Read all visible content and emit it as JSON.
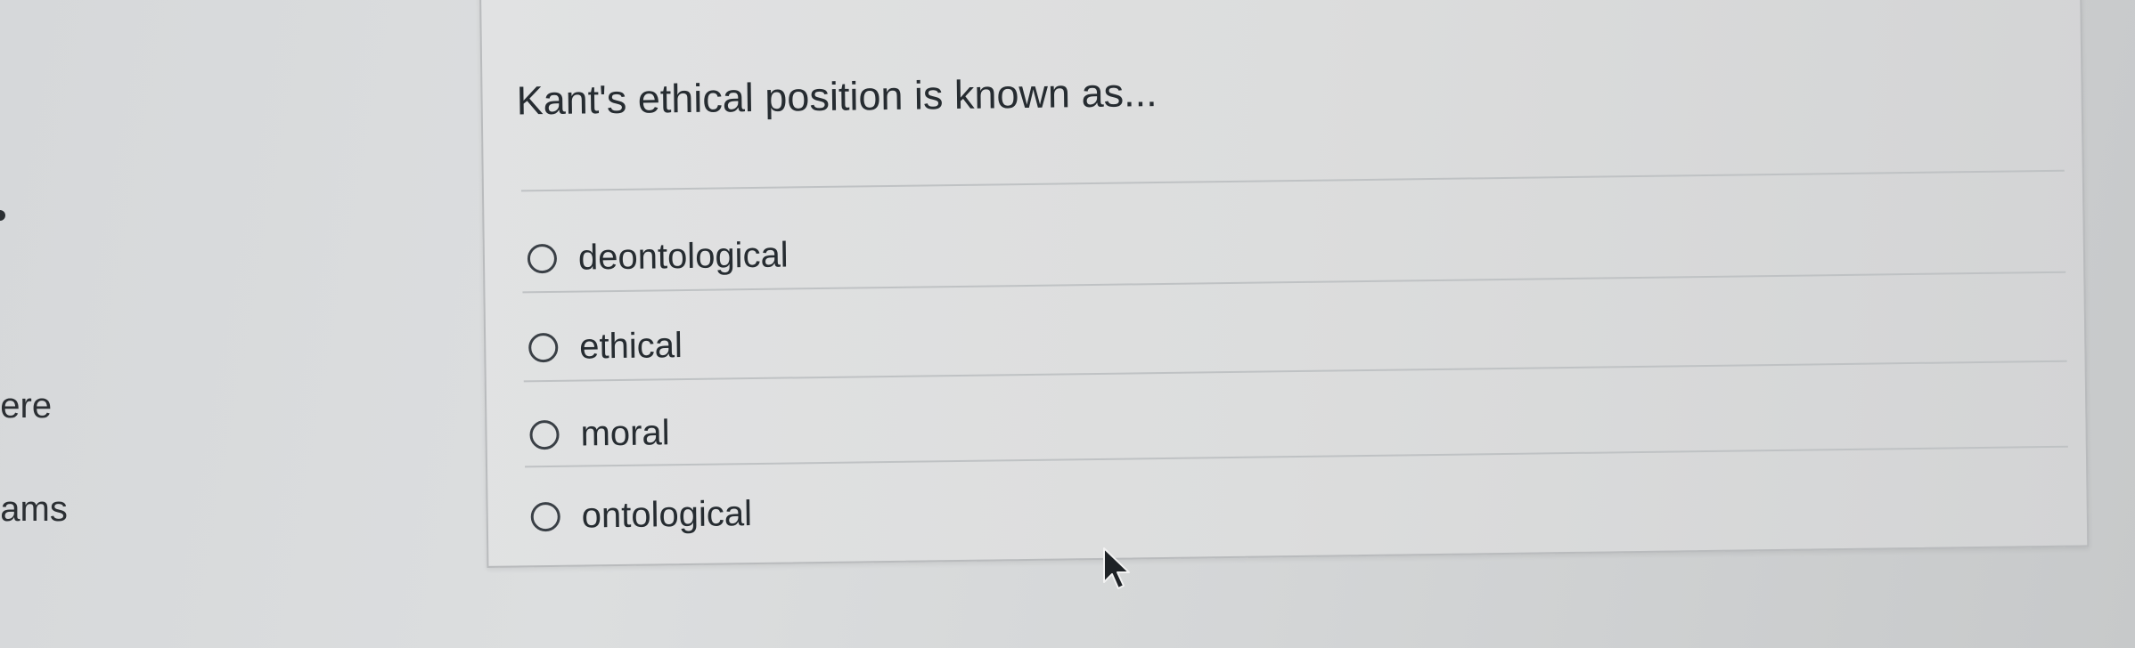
{
  "sidebar": {
    "items": [
      {
        "label": "nere"
      },
      {
        "label": "eams"
      }
    ]
  },
  "quiz": {
    "question": "Kant's ethical position is known as...",
    "answers": [
      {
        "label": "deontological"
      },
      {
        "label": "ethical"
      },
      {
        "label": "moral"
      },
      {
        "label": "ontological"
      }
    ]
  },
  "cursor": {
    "icon": "arrow-cursor-icon"
  }
}
